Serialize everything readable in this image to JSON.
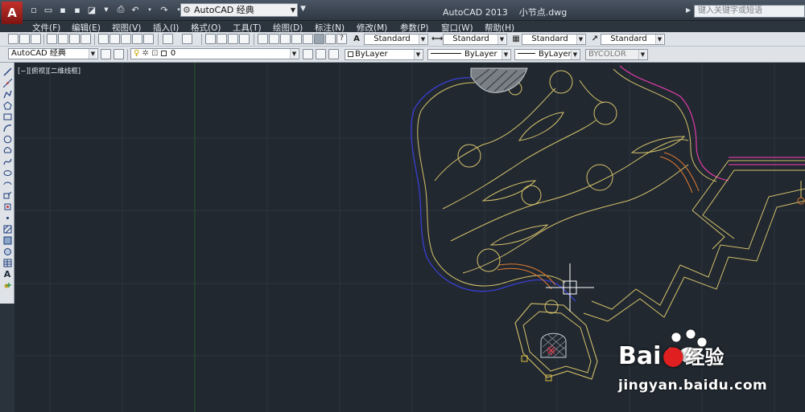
{
  "window": {
    "app_name": "AutoCAD 2013",
    "file_name": "小节点.dwg",
    "workspace": "AutoCAD 经典",
    "search_placeholder": "键入关键字或短语"
  },
  "menu": [
    "文件(F)",
    "编辑(E)",
    "视图(V)",
    "插入(I)",
    "格式(O)",
    "工具(T)",
    "绘图(D)",
    "标注(N)",
    "修改(M)",
    "参数(P)",
    "窗口(W)",
    "帮助(H)"
  ],
  "styles": {
    "text_style": "Standard",
    "dim_style": "Standard",
    "table_style": "Standard",
    "multileader_style": "Standard"
  },
  "layers": {
    "workspace_dropdown": "AutoCAD 经典",
    "current_layer": "0",
    "color": "ByLayer",
    "linetype": "ByLayer",
    "lineweight": "ByLayer",
    "plot_style": "BYCOLOR"
  },
  "viewport": {
    "label": "[−][俯视][二维线框]"
  },
  "watermark": {
    "brand": "Bai",
    "brand_cn": "经验",
    "url": "jingyan.baidu.com"
  },
  "icons": {
    "left_toolbar": [
      "line-icon",
      "construction-line-icon",
      "polyline-icon",
      "polygon-icon",
      "rectangle-icon",
      "arc-icon",
      "circle-icon",
      "revision-cloud-icon",
      "spline-icon",
      "ellipse-icon",
      "ellipse-arc-icon",
      "insert-block-icon",
      "make-block-icon",
      "point-icon",
      "hatch-icon",
      "gradient-icon",
      "region-icon",
      "table-icon",
      "mtext-icon",
      "add-selected-icon"
    ]
  },
  "colors": {
    "canvas_bg": "#212830",
    "drawing_yellow": "#d6c26a",
    "drawing_blue": "#3a3fd0",
    "drawing_magenta": "#d43aa0",
    "drawing_orange": "#e07a30",
    "accent_red": "#c4302b"
  }
}
